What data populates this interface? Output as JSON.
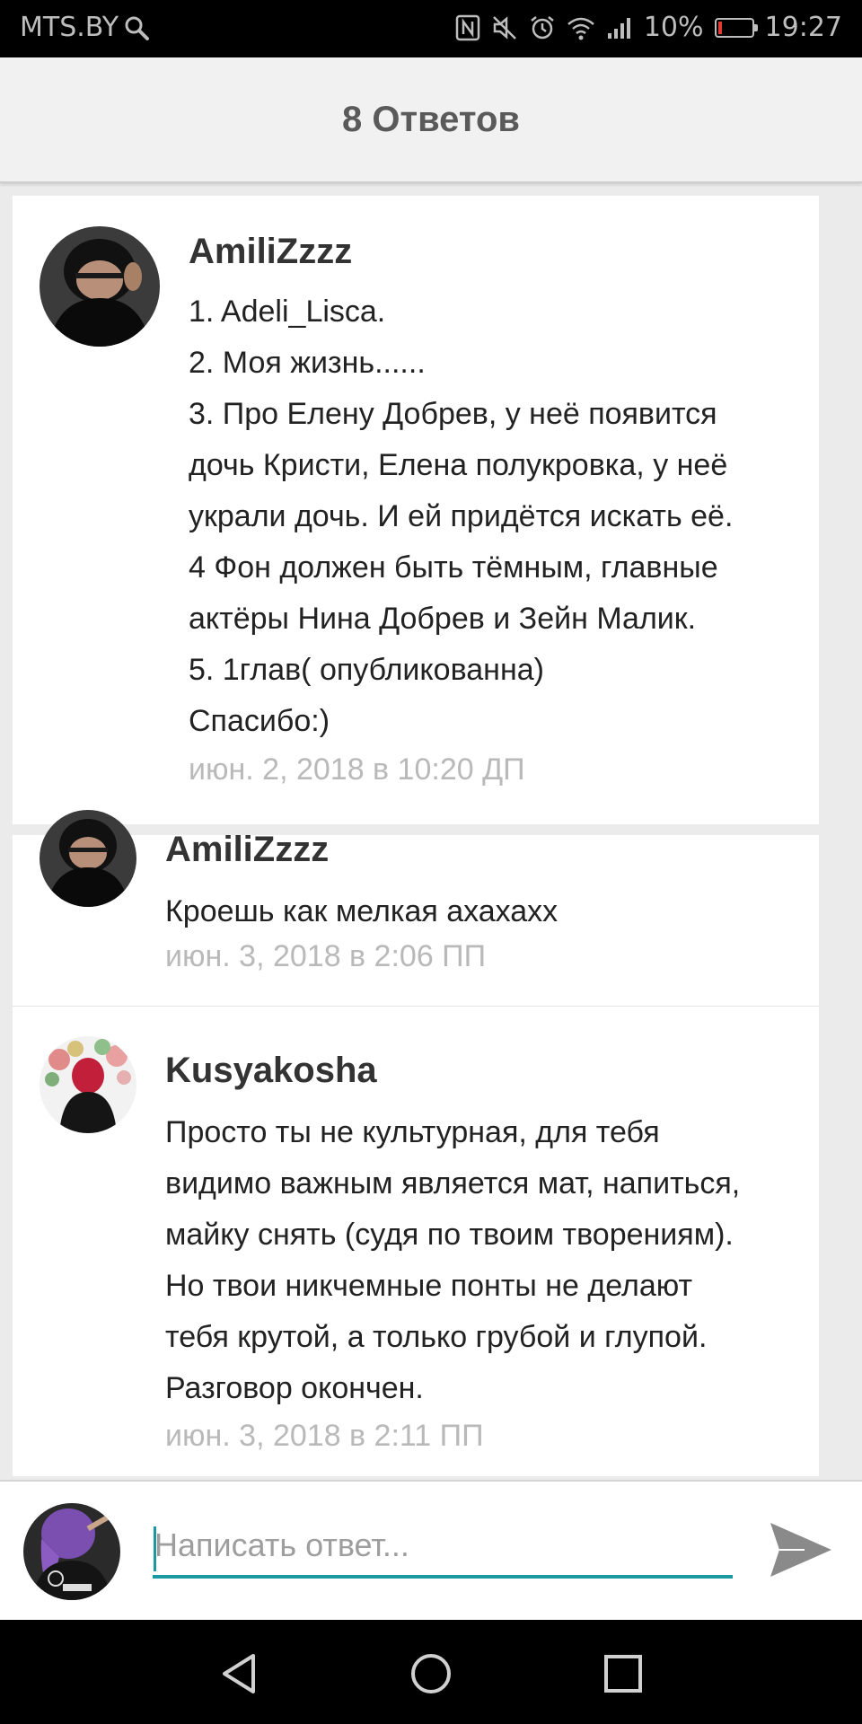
{
  "status_bar": {
    "carrier": "MTS.BY",
    "battery": "10%",
    "time": "19:27",
    "icons": [
      "search-icon",
      "nfc-icon",
      "mute-icon",
      "alarm-icon",
      "wifi-icon",
      "signal-icon",
      "battery-icon"
    ],
    "battery_color": "#e53935"
  },
  "header": {
    "title": "8 Ответов"
  },
  "comments": [
    {
      "user": "AmiliZzzz",
      "lines": [
        "1. Adeli_Lisca.",
        "2. Моя жизнь......",
        "3. Про Елену Добрев, у неё появится",
        "дочь Кристи, Елена полукровка,  у неё",
        "украли дочь. И ей придётся искать её.",
        "4 Фон должен быть тёмным, главные",
        "актёры Нина Добрев и Зейн Малик.",
        "5. 1глав( опубликованна)",
        "Спасибо:)"
      ],
      "time": "июн. 2, 2018 в 10:20 ДП"
    },
    {
      "user": "AmiliZzzz",
      "lines": [
        "Кроешь как мелкая ахахахх"
      ],
      "time": "июн. 3, 2018 в 2:06 ПП"
    },
    {
      "user": "Kusyakosha",
      "lines": [
        "Просто ты не культурная, для тебя",
        "видимо важным является мат, напиться,",
        "майку снять (судя по твоим творениям).",
        "Но твои никчемные понты не делают",
        "тебя крутой, а только грубой и глупой.",
        "Разговор окончен."
      ],
      "time": "июн. 3, 2018 в 2:11 ПП"
    }
  ],
  "reply": {
    "placeholder": "Написать ответ...",
    "value": ""
  },
  "colors": {
    "accent": "#1a9aa0",
    "timestamp": "#b9b9b9",
    "header_bg": "#f1f1f1"
  },
  "nav_bar": {
    "buttons": [
      "back-icon",
      "home-icon",
      "recents-icon"
    ]
  }
}
